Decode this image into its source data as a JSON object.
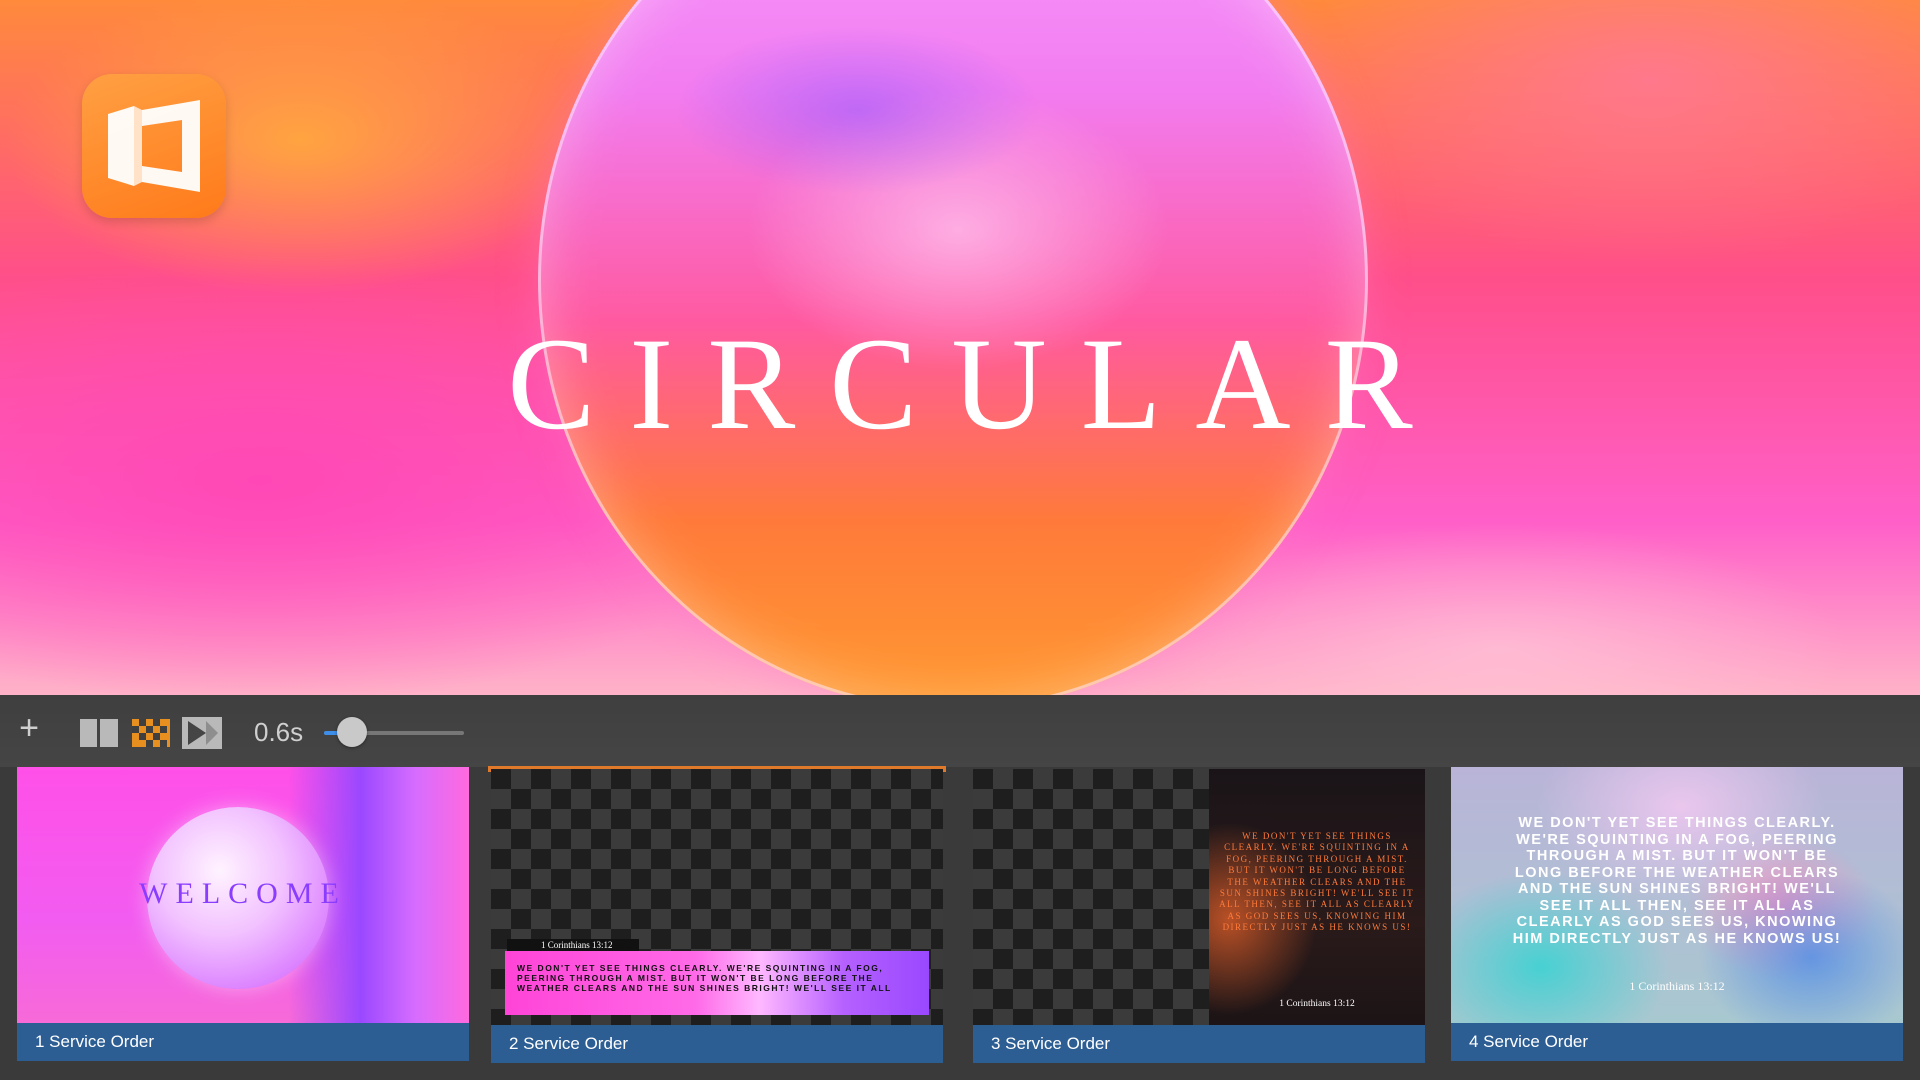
{
  "preview": {
    "title": "CIRCULAR",
    "logo_icon": "app-logo-icon"
  },
  "toolbar": {
    "add_icon": "plus-icon",
    "add_label": "+",
    "layout_icon": "layout-columns-icon",
    "transition_icon": "transition-dissolve-icon",
    "next_icon": "next-slide-icon",
    "speed_label": "0.6s",
    "speed_value_fraction": 0.2,
    "accent_color": "#3c8ee8"
  },
  "slides": [
    {
      "caption": "1 Service Order",
      "title": "WELCOME",
      "selected": false
    },
    {
      "caption": "2 Service Order",
      "reference": "1 Corinthians 13:12",
      "text": "WE DON'T YET SEE THINGS CLEARLY. WE'RE SQUINTING IN A FOG, PEERING THROUGH A MIST. BUT IT WON'T BE LONG BEFORE THE WEATHER CLEARS AND THE SUN SHINES BRIGHT! WE'LL SEE IT ALL",
      "selected": true,
      "selection_color": "#e07a2a"
    },
    {
      "caption": "3 Service Order",
      "text": "WE DON'T YET SEE THINGS CLEARLY. WE'RE SQUINTING IN A FOG, PEERING THROUGH A MIST. BUT IT WON'T BE LONG BEFORE THE WEATHER CLEARS AND THE SUN SHINES BRIGHT! WE'LL SEE IT ALL THEN, SEE IT ALL AS CLEARLY AS GOD SEES US, KNOWING HIM DIRECTLY JUST AS HE KNOWS US!",
      "reference": "1 Corinthians 13:12",
      "selected": false
    },
    {
      "caption": "4 Service Order",
      "text": "WE DON'T YET SEE THINGS CLEARLY. WE'RE SQUINTING IN A FOG, PEERING THROUGH A MIST. BUT IT WON'T BE LONG BEFORE THE WEATHER CLEARS AND THE SUN SHINES BRIGHT! WE'LL SEE IT ALL THEN, SEE IT ALL AS CLEARLY AS GOD SEES US, KNOWING HIM DIRECTLY JUST AS HE KNOWS US!",
      "reference": "1 Corinthians 13:12",
      "selected": false
    }
  ],
  "caption_color": "#2c5d93"
}
